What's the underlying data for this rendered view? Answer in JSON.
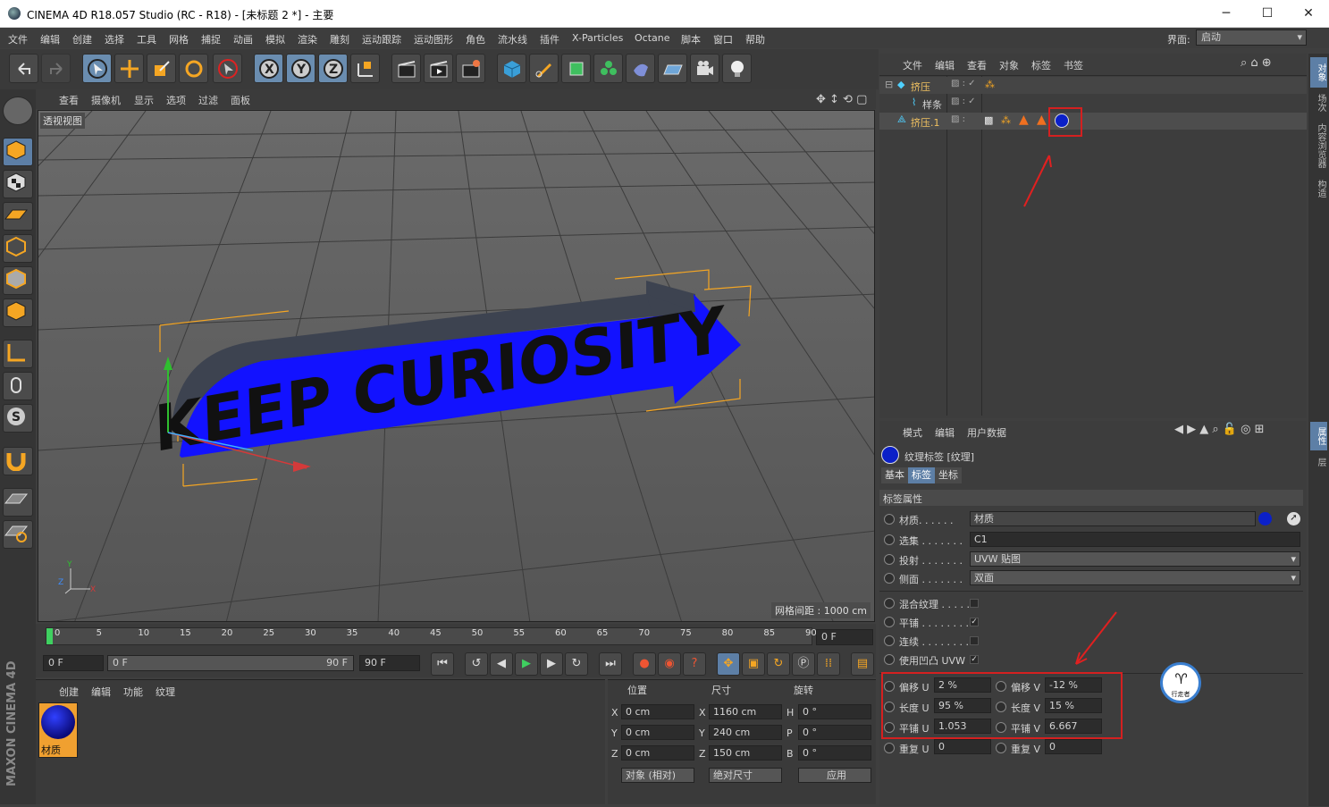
{
  "window": {
    "title": "CINEMA 4D R18.057 Studio (RC - R18) - [未标题 2 *] - 主要",
    "min": "─",
    "max": "☐",
    "close": "✕"
  },
  "menu": [
    "文件",
    "编辑",
    "创建",
    "选择",
    "工具",
    "网格",
    "捕捉",
    "动画",
    "模拟",
    "渲染",
    "雕刻",
    "运动跟踪",
    "运动图形",
    "角色",
    "流水线",
    "插件",
    "X-Particles",
    "Octane",
    "脚本",
    "窗口",
    "帮助"
  ],
  "layout": {
    "label": "界面:",
    "value": "启动"
  },
  "viewport": {
    "menu": [
      "查看",
      "摄像机",
      "显示",
      "选项",
      "过滤",
      "面板"
    ],
    "name": "透视视图",
    "grid_info": "网格间距 : 1000 cm",
    "text3d": "KEEP CURIOSITY"
  },
  "timeline": {
    "ticks": [
      "0",
      "5",
      "10",
      "15",
      "20",
      "25",
      "30",
      "35",
      "40",
      "45",
      "50",
      "55",
      "60",
      "65",
      "70",
      "75",
      "80",
      "85",
      "90"
    ],
    "end_field": "0 F"
  },
  "playback": {
    "current": "0 F",
    "range_start": "0 F",
    "range_end": "90 F",
    "max": "90 F"
  },
  "material_manager": {
    "menu": [
      "创建",
      "编辑",
      "功能",
      "纹理"
    ],
    "material_name": "材质"
  },
  "coords": {
    "headers": [
      "位置",
      "尺寸",
      "旋转"
    ],
    "rows": [
      {
        "axis": "X",
        "pos": "0 cm",
        "size_axis": "X",
        "size": "1160 cm",
        "rot_axis": "H",
        "rot": "0 °"
      },
      {
        "axis": "Y",
        "pos": "0 cm",
        "size_axis": "Y",
        "size": "240 cm",
        "rot_axis": "P",
        "rot": "0 °"
      },
      {
        "axis": "Z",
        "pos": "0 cm",
        "size_axis": "Z",
        "size": "150 cm",
        "rot_axis": "B",
        "rot": "0 °"
      }
    ],
    "mode1": "对象 (相对)",
    "mode2": "绝对尺寸",
    "apply": "应用"
  },
  "object_manager": {
    "menu": [
      "文件",
      "编辑",
      "查看",
      "对象",
      "标签",
      "书签"
    ],
    "objects": [
      {
        "name": "挤压"
      },
      {
        "name": "样条"
      },
      {
        "name": "挤压.1"
      }
    ]
  },
  "attributes": {
    "menu": [
      "模式",
      "编辑",
      "用户数据"
    ],
    "header": "纹理标签 [纹理]",
    "tabs": [
      "基本",
      "标签",
      "坐标"
    ],
    "section": "标签属性",
    "material_label": "材质. . . . . .",
    "material_value": "材质",
    "selection_label": "选集 . . . . . . .",
    "selection_value": "C1",
    "projection_label": "投射 . . . . . . .",
    "projection_value": "UVW 贴图",
    "side_label": "侧面 . . . . . . .",
    "side_value": "双面",
    "mix_label": "混合纹理 . . . . .",
    "tile_label": "平铺 . . . . . . . .",
    "seamless_label": "连续 . . . . . . . .",
    "bump_label": "使用凹凸 UVW",
    "offset_u_label": "偏移 U",
    "offset_u": "2 %",
    "offset_v_label": "偏移 V",
    "offset_v": "-12 %",
    "length_u_label": "长度 U",
    "length_u": "95 %",
    "length_v_label": "长度 V",
    "length_v": "15 %",
    "tiles_u_label": "平铺 U",
    "tiles_u": "1.053",
    "tiles_v_label": "平铺 V",
    "tiles_v": "6.667",
    "repeat_u_label": "重复 U",
    "repeat_u": "0",
    "repeat_v_label": "重复 V",
    "repeat_v": "0"
  },
  "side_tabs_top": [
    "对象",
    "场次",
    "内容浏览器",
    "构造"
  ],
  "side_tabs_bottom": [
    "属性",
    "层"
  ],
  "watermark": "行走者",
  "brand": "MAXON CINEMA 4D",
  "colors": {
    "accent": "#5d7fa6",
    "highlight": "#d42020",
    "text_blue": "#1010ff"
  }
}
